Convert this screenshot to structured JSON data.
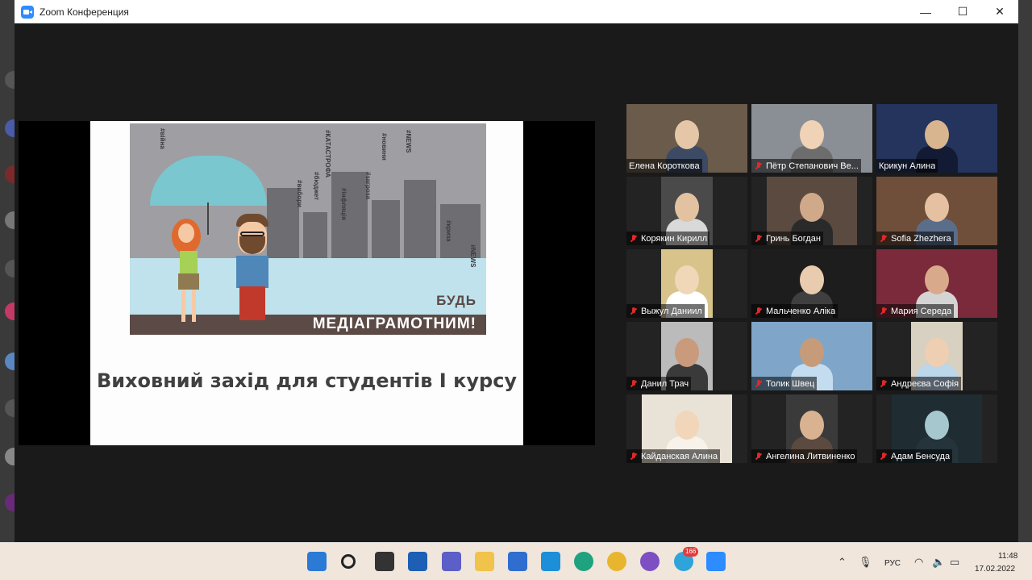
{
  "window": {
    "title": "Zoom Конференция",
    "min": "—",
    "max": "☐",
    "close": "✕"
  },
  "slide": {
    "caption_small": "БУДЬ",
    "caption_big": "МЕДІАГРАМОТНИМ!",
    "heading": "Виховний захід для студентів І курсу",
    "tags": [
      "#КАТАСТРОФА",
      "#бюджет",
      "#NEWS",
      "#новини",
      "#загроза",
      "#вибори",
      "#інфляція",
      "#криза",
      "#війна",
      "#NEWS"
    ]
  },
  "participants": [
    {
      "name": "Елена Короткова",
      "muted": false,
      "active": false
    },
    {
      "name": "Пётр Степанович Ве...",
      "muted": true,
      "active": false
    },
    {
      "name": "Крикун Алина",
      "muted": false,
      "active": true
    },
    {
      "name": "Корякин Кирилл",
      "muted": true,
      "active": false
    },
    {
      "name": "Гринь Богдан",
      "muted": true,
      "active": false
    },
    {
      "name": "Sofia Zhezhera",
      "muted": true,
      "active": false
    },
    {
      "name": "Выжул Даниил",
      "muted": true,
      "active": false
    },
    {
      "name": "Мальченко Аліка",
      "muted": true,
      "active": false
    },
    {
      "name": "Мария Середа",
      "muted": true,
      "active": false
    },
    {
      "name": "Данил Трач",
      "muted": true,
      "active": false
    },
    {
      "name": "Толик Швец",
      "muted": true,
      "active": false
    },
    {
      "name": "Андреєва Софія",
      "muted": true,
      "active": false
    },
    {
      "name": "Кайданская Алина",
      "muted": true,
      "active": false
    },
    {
      "name": "Ангелина Литвиненко",
      "muted": true,
      "active": false
    },
    {
      "name": "Адам Бенсуда",
      "muted": true,
      "active": false
    }
  ],
  "taskbar": {
    "badge": "166",
    "lang": "РУС",
    "time": "11:48",
    "date": "17.02.2022"
  }
}
